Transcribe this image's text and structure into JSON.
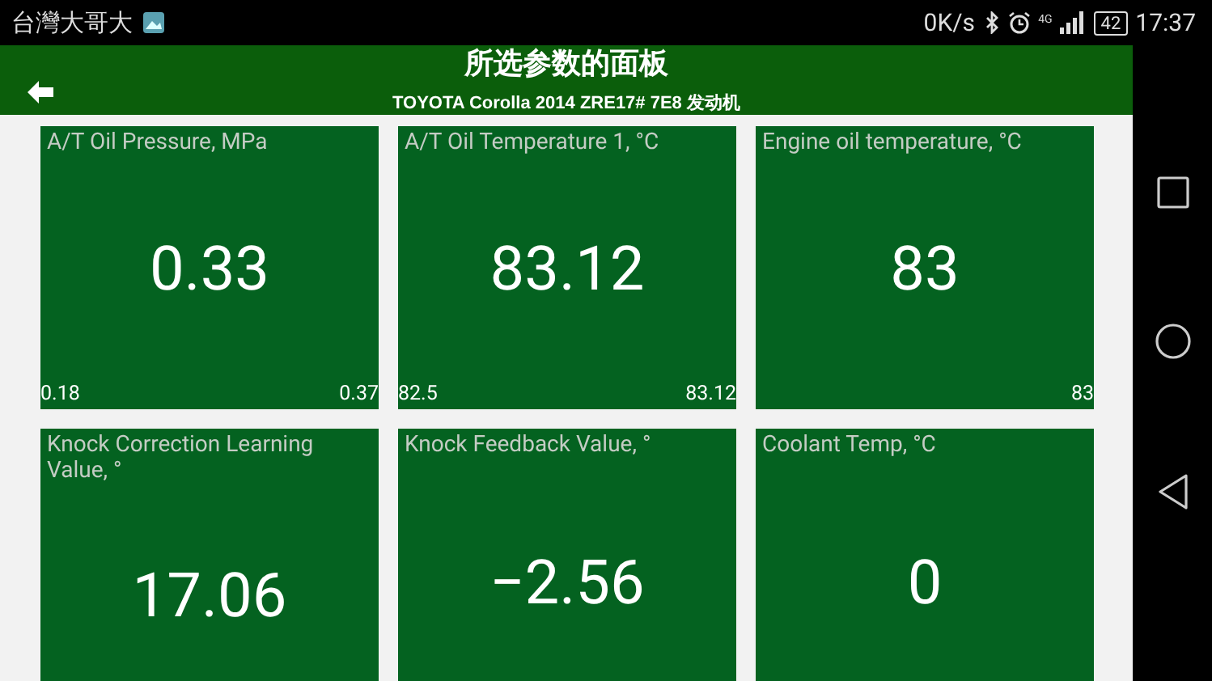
{
  "status_bar": {
    "carrier": "台灣大哥大",
    "speed": "0K/s",
    "network": "4G",
    "battery": "42",
    "time": "17:37"
  },
  "header": {
    "title": "所选参数的面板",
    "subtitle": "TOYOTA Corolla 2014 ZRE17# 7E8 发动机"
  },
  "tiles": [
    {
      "title": "A/T Oil Pressure, MPa",
      "value": "0.33",
      "min": "0.18",
      "max": "0.37"
    },
    {
      "title": "A/T Oil Temperature 1, °C",
      "value": "83.12",
      "min": "82.5",
      "max": "83.12"
    },
    {
      "title": "Engine oil temperature, °C",
      "value": "83",
      "max": "83"
    },
    {
      "title": "Knock Correction Learning Value, °",
      "value": "17.06"
    },
    {
      "title": "Knock Feedback Value, °",
      "value": "−2.56"
    },
    {
      "title": "Coolant Temp, °C",
      "value": "0"
    }
  ]
}
